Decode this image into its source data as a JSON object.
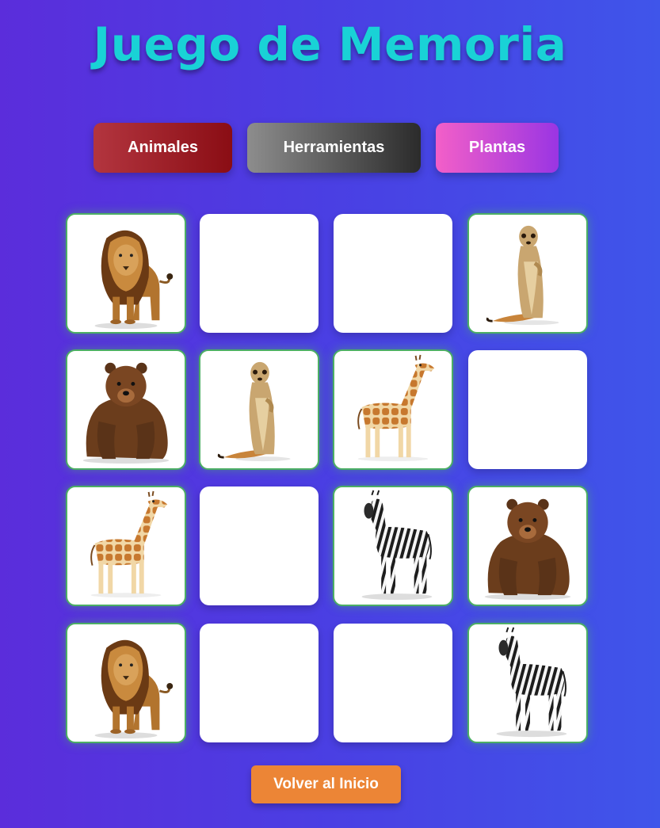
{
  "title": "Juego de Memoria",
  "categories": [
    {
      "label": "Animales",
      "color_start": "#b3353f",
      "color_end": "#8a0d14"
    },
    {
      "label": "Herramientas",
      "color_start": "#8d8d8d",
      "color_end": "#2b2b2b"
    },
    {
      "label": "Plantas",
      "color_start": "#f35fc8",
      "color_end": "#9a35e3"
    }
  ],
  "board": {
    "rows": [
      [
        "lion",
        "hidden",
        "hidden",
        "meerkat"
      ],
      [
        "bear",
        "meerkat",
        "giraffe",
        "hidden"
      ],
      [
        "giraffe",
        "hidden",
        "zebra",
        "bear"
      ],
      [
        "lion",
        "hidden",
        "hidden",
        "zebra"
      ]
    ],
    "matched_border_color": "#4caf64"
  },
  "back_button": {
    "label": "Volver al Inicio",
    "color": "#ec8536"
  }
}
